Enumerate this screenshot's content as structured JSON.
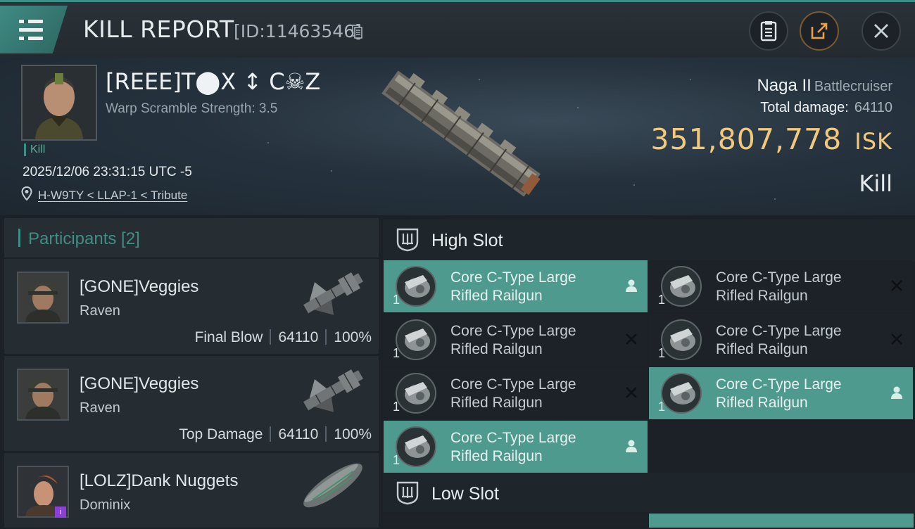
{
  "header": {
    "title": "KILL REPORT",
    "report_id": "[ID:11463546]"
  },
  "victim": {
    "name": "[REEE]T⬤X ↕ C☠Z",
    "warp_scramble": "Warp Scramble Strength: 3.5",
    "result_tag": "Kill",
    "datetime": "2025/12/06 23:31:15 UTC -5",
    "location": "H-W9TY < LLAP-1 < Tribute"
  },
  "ship": {
    "name": "Naga II",
    "class": "Battlecruiser",
    "total_damage_label": "Total damage:",
    "total_damage": "64110",
    "isk_value": "351,807,778",
    "isk_unit": "ISK",
    "outcome": "Kill"
  },
  "participants": {
    "title": "Participants [2]",
    "rows": [
      {
        "name": "[GONE]Veggies",
        "ship": "Raven",
        "label": "Final Blow",
        "damage": "64110",
        "percent": "100%"
      },
      {
        "name": "[GONE]Veggies",
        "ship": "Raven",
        "label": "Top Damage",
        "damage": "64110",
        "percent": "100%"
      },
      {
        "name": "[LOLZ]Dank Nuggets",
        "ship": "Dominix",
        "label": "",
        "damage": "",
        "percent": ""
      }
    ]
  },
  "slots": {
    "high_title": "High Slot",
    "low_title": "Low Slot",
    "items": [
      {
        "line1": "Core C-Type Large",
        "line2": "Rifled Railgun",
        "qty": "1",
        "state": "dropped"
      },
      {
        "line1": "Core C-Type Large",
        "line2": "Rifled Railgun",
        "qty": "1",
        "state": "destroyed"
      },
      {
        "line1": "Core C-Type Large",
        "line2": "Rifled Railgun",
        "qty": "1",
        "state": "destroyed"
      },
      {
        "line1": "Core C-Type Large",
        "line2": "Rifled Railgun",
        "qty": "1",
        "state": "destroyed"
      },
      {
        "line1": "Core C-Type Large",
        "line2": "Rifled Railgun",
        "qty": "1",
        "state": "destroyed"
      },
      {
        "line1": "Core C-Type Large",
        "line2": "Rifled Railgun",
        "qty": "1",
        "state": "dropped"
      },
      {
        "line1": "Core C-Type Large",
        "line2": "Rifled Railgun",
        "qty": "1",
        "state": "dropped"
      }
    ]
  },
  "colors": {
    "accent": "#3c8f86",
    "highlight_row": "#4e9a8e",
    "isk": "#f2c97c"
  },
  "icons": [
    "menu-icon",
    "copy-icon",
    "clipboard-icon",
    "share-icon",
    "close-icon",
    "location-pin-icon",
    "high-slot-icon",
    "low-slot-icon",
    "pilot-icon",
    "destroyed-x-icon"
  ]
}
